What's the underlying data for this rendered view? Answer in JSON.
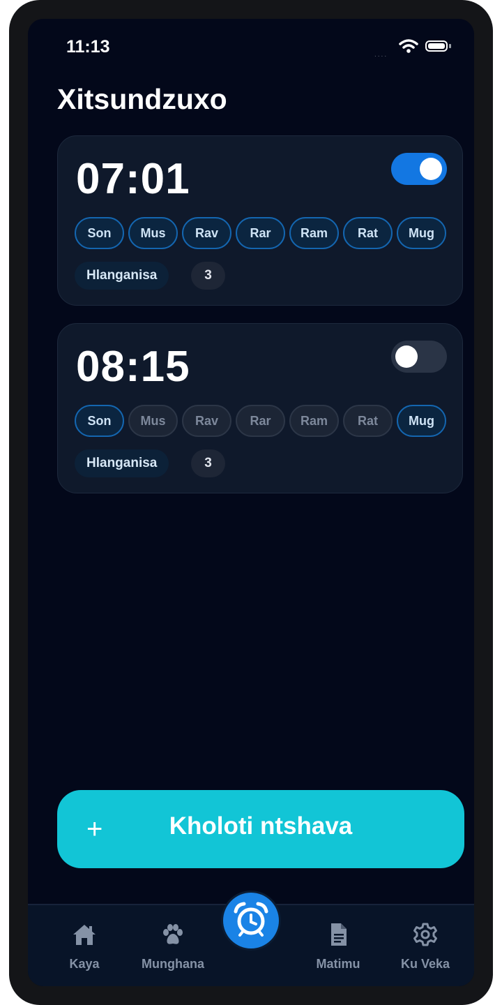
{
  "status": {
    "time": "11:13",
    "signal": "....",
    "wifi_icon": "wifi-icon",
    "battery_icon": "battery-icon"
  },
  "header": {
    "title": "Xitsundzuxo"
  },
  "alarms": [
    {
      "time": "07:01",
      "enabled": true,
      "days": [
        {
          "label": "Son",
          "active": true
        },
        {
          "label": "Mus",
          "active": true
        },
        {
          "label": "Rav",
          "active": true
        },
        {
          "label": "Rar",
          "active": true
        },
        {
          "label": "Ram",
          "active": true
        },
        {
          "label": "Rat",
          "active": true
        },
        {
          "label": "Mug",
          "active": true
        }
      ],
      "snooze_label": "Hlanganisa",
      "snooze_count": "3"
    },
    {
      "time": "08:15",
      "enabled": false,
      "days": [
        {
          "label": "Son",
          "active": true
        },
        {
          "label": "Mus",
          "active": false
        },
        {
          "label": "Rav",
          "active": false
        },
        {
          "label": "Rar",
          "active": false
        },
        {
          "label": "Ram",
          "active": false
        },
        {
          "label": "Rat",
          "active": false
        },
        {
          "label": "Mug",
          "active": true
        }
      ],
      "snooze_label": "Hlanganisa",
      "snooze_count": "3"
    }
  ],
  "new_alarm": {
    "plus": "+",
    "label": "Kholoti ntshava"
  },
  "tabs": [
    {
      "label": "Kaya",
      "icon": "home-icon"
    },
    {
      "label": "Munghana",
      "icon": "paw-icon"
    },
    {
      "label": "",
      "icon": "alarm-clock-icon",
      "active": true
    },
    {
      "label": "Matimu",
      "icon": "document-icon"
    },
    {
      "label": "Ku Veka",
      "icon": "gear-icon"
    }
  ],
  "colors": {
    "accent": "#1a83e6",
    "cta": "#12c5d6",
    "background": "#03081a",
    "card": "#0f192b"
  }
}
